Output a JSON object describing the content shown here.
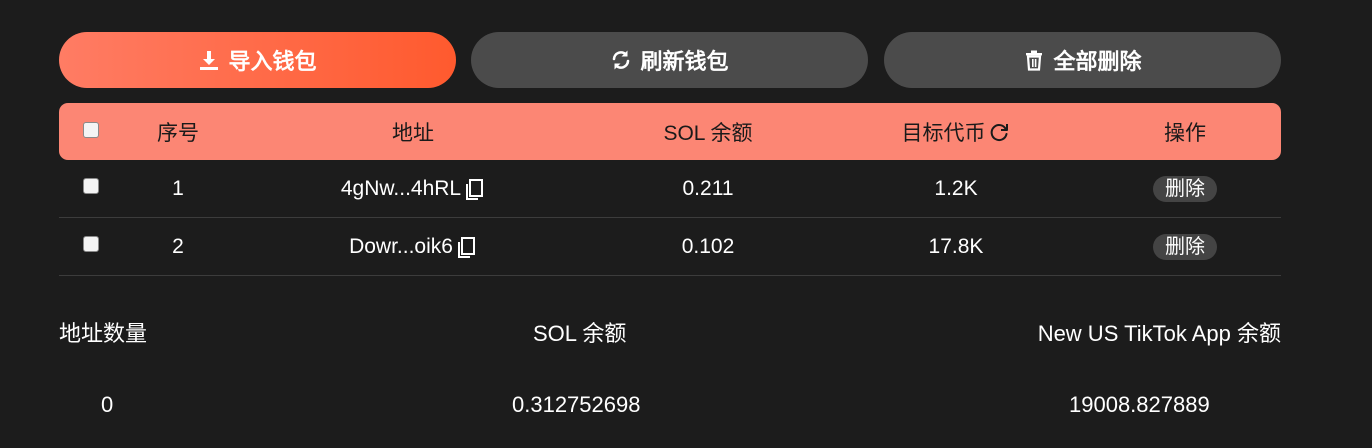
{
  "toolbar": {
    "import_label": "导入钱包",
    "refresh_label": "刷新钱包",
    "delete_all_label": "全部删除"
  },
  "table": {
    "headers": {
      "index": "序号",
      "address": "地址",
      "sol_balance": "SOL 余额",
      "target_token": "目标代币",
      "action": "操作"
    },
    "rows": [
      {
        "index": "1",
        "address": "4gNw...4hRL",
        "sol": "0.211",
        "token": "1.2K",
        "action": "删除"
      },
      {
        "index": "2",
        "address": "Dowr...oik6",
        "sol": "0.102",
        "token": "17.8K",
        "action": "删除"
      }
    ]
  },
  "summary": {
    "address_count_label": "地址数量",
    "address_count_value": "0",
    "sol_label": "SOL 余额",
    "sol_value": "0.312752698",
    "token_label": "New US TikTok App 余额",
    "token_value": "19008.827889"
  },
  "colors": {
    "accent_start": "#ff7c64",
    "accent_end": "#ff5a2e",
    "header_bg": "#fc8674",
    "background": "#1c1c1c",
    "secondary_button": "#4b4b4b"
  },
  "icons": {
    "import": "download-icon",
    "refresh": "refresh-icon",
    "delete_all": "trash-icon",
    "copy": "copy-icon",
    "token_refresh": "refresh-icon"
  }
}
